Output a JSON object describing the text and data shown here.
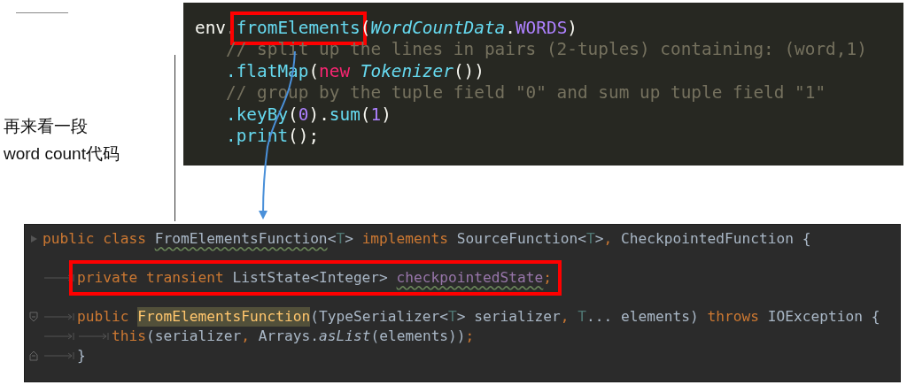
{
  "caption": {
    "lines": [
      "再来看一段",
      "word count代码"
    ]
  },
  "top_code": {
    "lines": [
      {
        "tokens": [
          {
            "text": "env.",
            "kind": "plain"
          },
          {
            "text": "fromElements",
            "kind": "method",
            "boxed": true
          },
          {
            "text": "(",
            "kind": "plain"
          },
          {
            "text": "WordCountData",
            "kind": "class"
          },
          {
            "text": ".",
            "kind": "plain"
          },
          {
            "text": "WORDS",
            "kind": "constant"
          },
          {
            "text": ")",
            "kind": "plain"
          }
        ]
      },
      {
        "tokens": [
          {
            "text": "   // split up the lines in pairs (2-tuples) containing: (word,1)",
            "kind": "comment"
          }
        ]
      },
      {
        "tokens": [
          {
            "text": "   .flatMap",
            "kind": "method"
          },
          {
            "text": "(",
            "kind": "plain"
          },
          {
            "text": "new ",
            "kind": "keyword"
          },
          {
            "text": "Tokenizer",
            "kind": "class"
          },
          {
            "text": "())",
            "kind": "plain"
          }
        ]
      },
      {
        "tokens": [
          {
            "text": "   // group by the tuple field \"0\" and sum up tuple field \"1\"",
            "kind": "comment"
          }
        ]
      },
      {
        "tokens": [
          {
            "text": "   .keyBy",
            "kind": "method"
          },
          {
            "text": "(",
            "kind": "plain"
          },
          {
            "text": "0",
            "kind": "number"
          },
          {
            "text": ").",
            "kind": "plain"
          },
          {
            "text": "sum",
            "kind": "method"
          },
          {
            "text": "(",
            "kind": "plain"
          },
          {
            "text": "1",
            "kind": "number"
          },
          {
            "text": ")",
            "kind": "plain"
          }
        ]
      },
      {
        "tokens": [
          {
            "text": "   .print",
            "kind": "method"
          },
          {
            "text": "();",
            "kind": "plain"
          }
        ]
      }
    ]
  },
  "bottom_code": {
    "lines": [
      {
        "boxed": false,
        "blank_after": true,
        "tokens": [
          {
            "kind": "run-marker"
          },
          {
            "text": "public class ",
            "kind": "keyword"
          },
          {
            "text": "FromElementsFunction",
            "kind": "plain",
            "squiggle": true
          },
          {
            "text": "<",
            "kind": "plain"
          },
          {
            "text": "T",
            "kind": "typeparam"
          },
          {
            "text": "> ",
            "kind": "plain"
          },
          {
            "text": "implements ",
            "kind": "keyword"
          },
          {
            "text": "SourceFunction<",
            "kind": "plain"
          },
          {
            "text": "T",
            "kind": "typeparam"
          },
          {
            "text": ">",
            "kind": "plain"
          },
          {
            "text": ", ",
            "kind": "keyword"
          },
          {
            "text": "CheckpointedFunction {",
            "kind": "plain"
          }
        ]
      },
      {
        "boxed": true,
        "blank_after": true,
        "tokens": [
          {
            "kind": "tab"
          },
          {
            "text": "private transient ",
            "kind": "keyword"
          },
          {
            "text": "ListState<Integer> ",
            "kind": "plain"
          },
          {
            "text": "checkpointedState",
            "kind": "field",
            "squiggle": true
          },
          {
            "text": ";",
            "kind": "keyword"
          }
        ]
      },
      {
        "boxed": false,
        "blank_after": false,
        "tokens": [
          {
            "kind": "fold-start"
          },
          {
            "kind": "tab"
          },
          {
            "text": "public ",
            "kind": "keyword"
          },
          {
            "text": "FromElementsFunction",
            "kind": "method",
            "highlight": true
          },
          {
            "text": "(TypeSerializer<",
            "kind": "plain"
          },
          {
            "text": "T",
            "kind": "typeparam"
          },
          {
            "text": "> serializer",
            "kind": "plain"
          },
          {
            "text": ", ",
            "kind": "keyword"
          },
          {
            "text": "T",
            "kind": "typeparam"
          },
          {
            "text": "... elements) ",
            "kind": "plain"
          },
          {
            "text": "throws ",
            "kind": "keyword"
          },
          {
            "text": "IOException {",
            "kind": "plain"
          }
        ]
      },
      {
        "boxed": false,
        "blank_after": false,
        "tokens": [
          {
            "kind": "tab"
          },
          {
            "kind": "tab"
          },
          {
            "text": "this",
            "kind": "keyword"
          },
          {
            "text": "(serializer",
            "kind": "plain"
          },
          {
            "text": ", ",
            "kind": "keyword"
          },
          {
            "text": "Arrays.",
            "kind": "plain"
          },
          {
            "text": "asList",
            "kind": "italic"
          },
          {
            "text": "(elements))",
            "kind": "plain"
          },
          {
            "text": ";",
            "kind": "keyword"
          }
        ]
      },
      {
        "boxed": false,
        "blank_after": false,
        "tokens": [
          {
            "kind": "fold-end"
          },
          {
            "kind": "tab"
          },
          {
            "text": "}",
            "kind": "plain"
          }
        ]
      }
    ]
  }
}
